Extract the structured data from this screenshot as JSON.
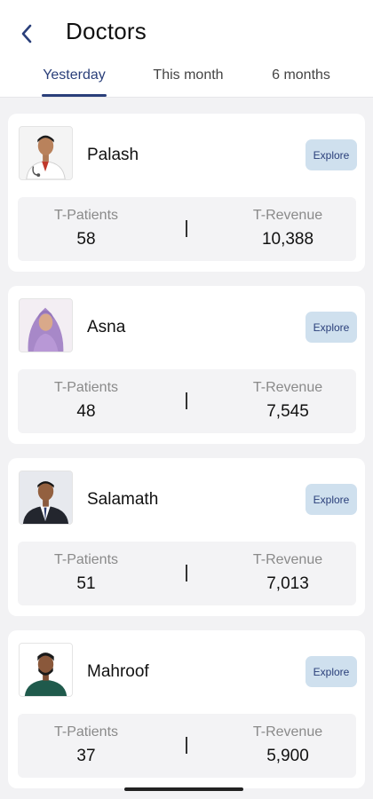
{
  "header": {
    "title": "Doctors",
    "back_icon": "chevron-left-icon"
  },
  "tabs": [
    {
      "label": "Yesterday",
      "active": true
    },
    {
      "label": "This month",
      "active": false
    },
    {
      "label": "6 months",
      "active": false
    }
  ],
  "colors": {
    "accent": "#2a3f7a",
    "explore_bg": "#cfe0ee",
    "page_bg": "#f2f2f4",
    "card_bg": "#ffffff",
    "stats_bg": "#f3f3f5"
  },
  "doctors": [
    {
      "name": "Palash",
      "avatar_icon": "doctor-photo-icon",
      "explore_label": "Explore",
      "patients_label": "T-Patients",
      "patients": "58",
      "revenue_label": "T-Revenue",
      "revenue": "10,388"
    },
    {
      "name": "Asna",
      "avatar_icon": "doctor-photo-icon",
      "explore_label": "Explore",
      "patients_label": "T-Patients",
      "patients": "48",
      "revenue_label": "T-Revenue",
      "revenue": "7,545"
    },
    {
      "name": "Salamath",
      "avatar_icon": "doctor-photo-icon",
      "explore_label": "Explore",
      "patients_label": "T-Patients",
      "patients": "51",
      "revenue_label": "T-Revenue",
      "revenue": "7,013"
    },
    {
      "name": "Mahroof",
      "avatar_icon": "doctor-photo-icon",
      "explore_label": "Explore",
      "patients_label": "T-Patients",
      "patients": "37",
      "revenue_label": "T-Revenue",
      "revenue": "5,900"
    }
  ]
}
